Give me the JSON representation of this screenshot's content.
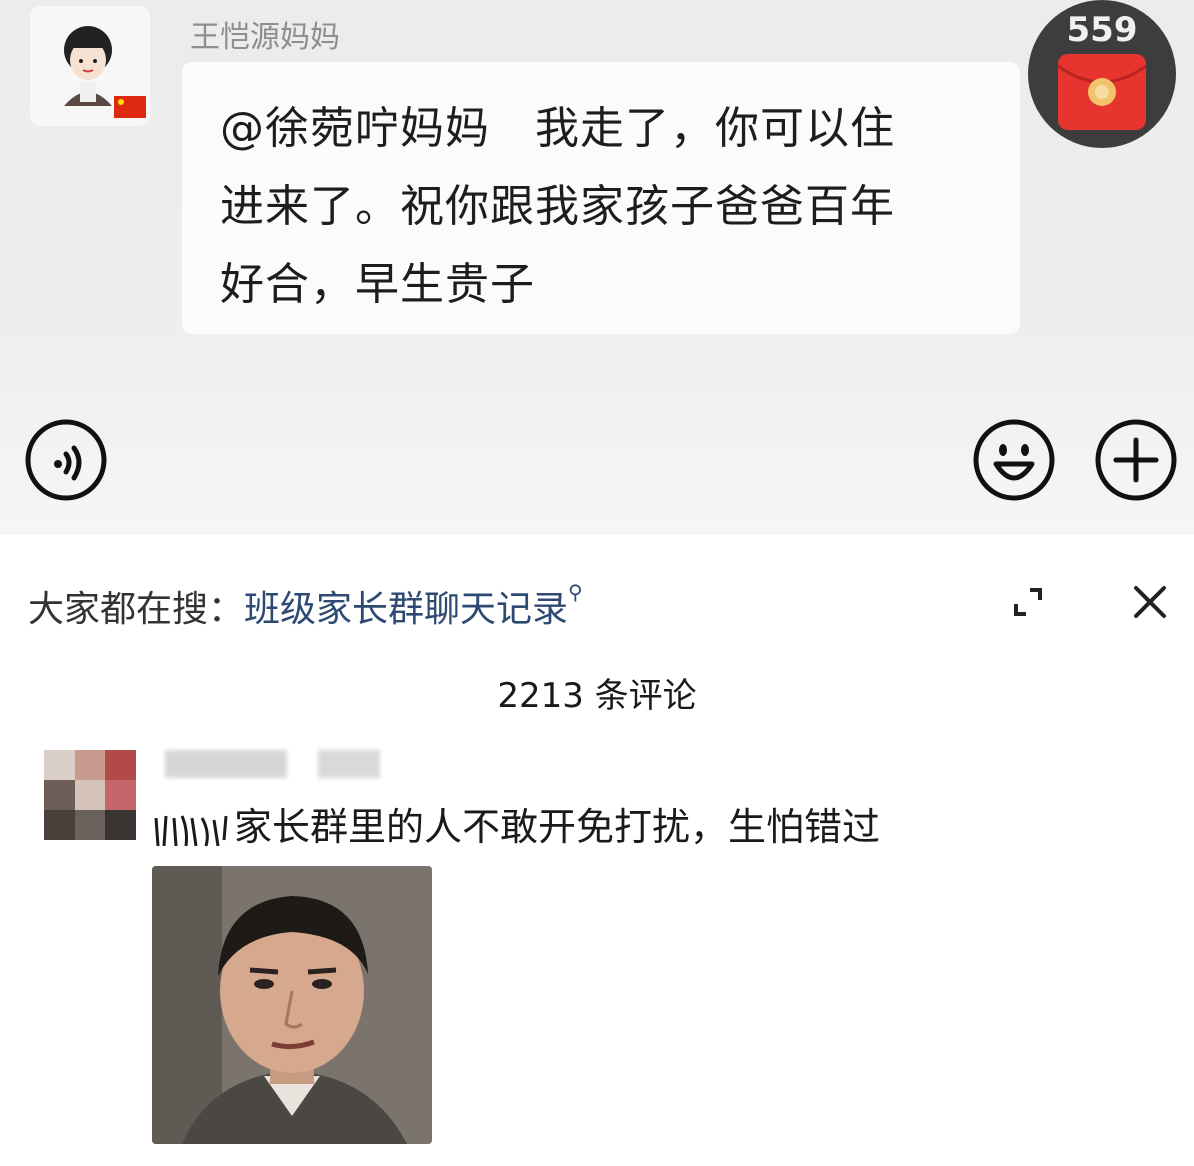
{
  "chat": {
    "sender_name": "王恺源妈妈",
    "message_line1": "@徐菀咛妈妈　我走了，你可以住",
    "message_line2": "进来了。祝你跟我家孩子爸爸百年",
    "message_line3": "好合，早生贵子",
    "red_packet_count": "559",
    "icons": [
      "voice-icon",
      "emoji-icon",
      "plus-icon",
      "red-packet-icon"
    ]
  },
  "search_hint": {
    "prefix": "大家都在搜：",
    "term": "班级家长群聊天记录",
    "icon": "search-icon"
  },
  "controls": {
    "expand_icon": "expand-icon",
    "close_icon": "close-icon"
  },
  "comments": {
    "count_label": "2213 条评论",
    "items": [
      {
        "text": "家长群里的人不敢开免打扰，生怕错过"
      }
    ]
  },
  "colors": {
    "chat_bg": "#ececec",
    "link": "#2e4a73",
    "red_packet": "#e8342f"
  }
}
